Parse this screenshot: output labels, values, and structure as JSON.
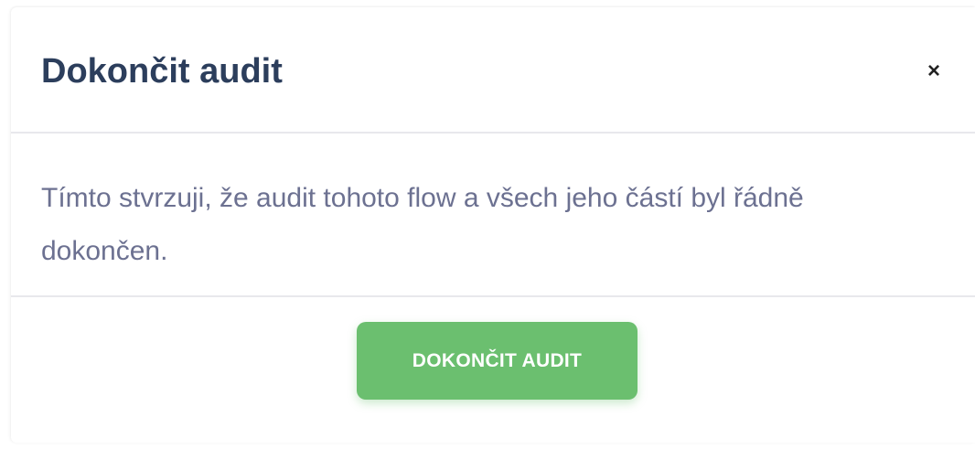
{
  "modal": {
    "title": "Dokončit audit",
    "close_label": "×",
    "body_text": "Tímto stvrzuji, že audit tohoto flow a všech jeho částí byl řádně dokončen.",
    "confirm_label": "DOKONČIT AUDIT"
  },
  "colors": {
    "title": "#2c3e5c",
    "body_text": "#6c7191",
    "confirm_button": "#6bbf6f"
  }
}
